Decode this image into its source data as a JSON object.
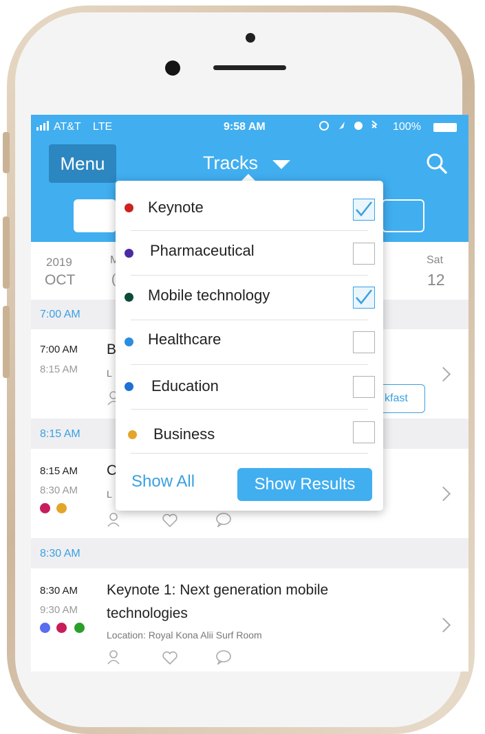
{
  "status_bar": {
    "carrier": "AT&T",
    "network": "LTE",
    "time": "9:58 AM",
    "battery": "100%"
  },
  "header": {
    "menu_label": "Menu",
    "title": "Tracks"
  },
  "date_bar": {
    "left_year": "2019",
    "left_month": "OCT",
    "partial_month_letter": "M",
    "partial_day_letter": "(",
    "right_day_name": "Sat",
    "right_day_num": "12"
  },
  "sections": [
    {
      "label": "7:00 AM"
    },
    {
      "label": "8:15 AM"
    },
    {
      "label": "8:30 AM"
    }
  ],
  "sessions": [
    {
      "start": "7:00 AM",
      "end": "8:15 AM",
      "title_partial": "B",
      "location_partial": "L",
      "tag_partial": "kfast"
    },
    {
      "start": "8:15 AM",
      "end": "8:30 AM",
      "title_partial": "C",
      "location_partial": "L"
    },
    {
      "start": "8:30 AM",
      "end": "9:30 AM",
      "title_line1": "Keynote 1: Next generation mobile",
      "title_line2": "technologies",
      "location": "Location: Royal Kona Alii Surf Room"
    }
  ],
  "dropdown": {
    "tracks": [
      {
        "label": "Keynote",
        "color": "#cc2222",
        "checked": true
      },
      {
        "label": "Pharmaceutical",
        "color": "#4b2aa6",
        "checked": false
      },
      {
        "label": "Mobile technology",
        "color": "#0d4a3a",
        "checked": true
      },
      {
        "label": "Healthcare",
        "color": "#2a8ee0",
        "checked": false
      },
      {
        "label": "Education",
        "color": "#1e6fd6",
        "checked": false
      },
      {
        "label": "Business",
        "color": "#e3a52a",
        "checked": false
      }
    ],
    "show_all": "Show All",
    "show_results": "Show Results"
  },
  "colors": {
    "accent": "#41aef0",
    "menu_bg": "#2c86c0"
  }
}
